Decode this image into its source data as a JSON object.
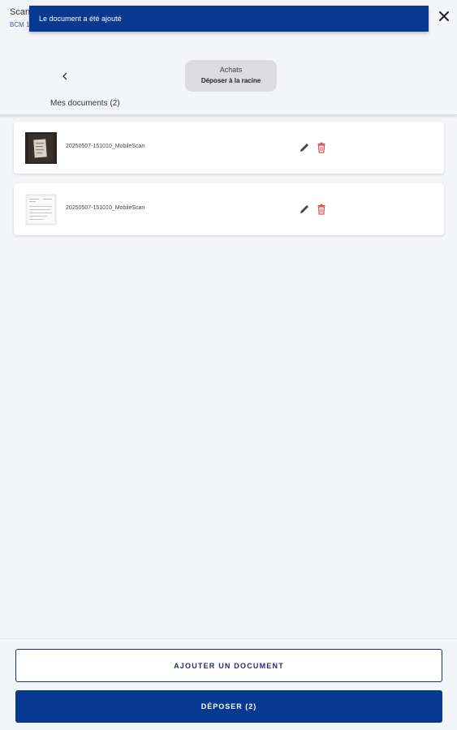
{
  "background": {
    "title": "Scan",
    "subtitle": "BCM 1"
  },
  "toast": {
    "message": "Le document a été ajouté"
  },
  "folder": {
    "name": "Achats",
    "action": "Déposer à la racine"
  },
  "documents": {
    "title": "Mes documents (2)",
    "items": [
      {
        "name": "20250507-151010_MobileScan"
      },
      {
        "name": "20250507-151010_MobileScan"
      }
    ]
  },
  "actions": {
    "add_label": "AJOUTER UN DOCUMENT",
    "submit_label": "DÉPOSER (2)"
  },
  "icons": {
    "close": "close-icon",
    "back": "chevron-left-icon",
    "edit": "pencil-icon",
    "delete": "trash-icon"
  },
  "colors": {
    "primary": "#06398f",
    "delete": "#d9534f",
    "background": "#f4f5f9"
  }
}
